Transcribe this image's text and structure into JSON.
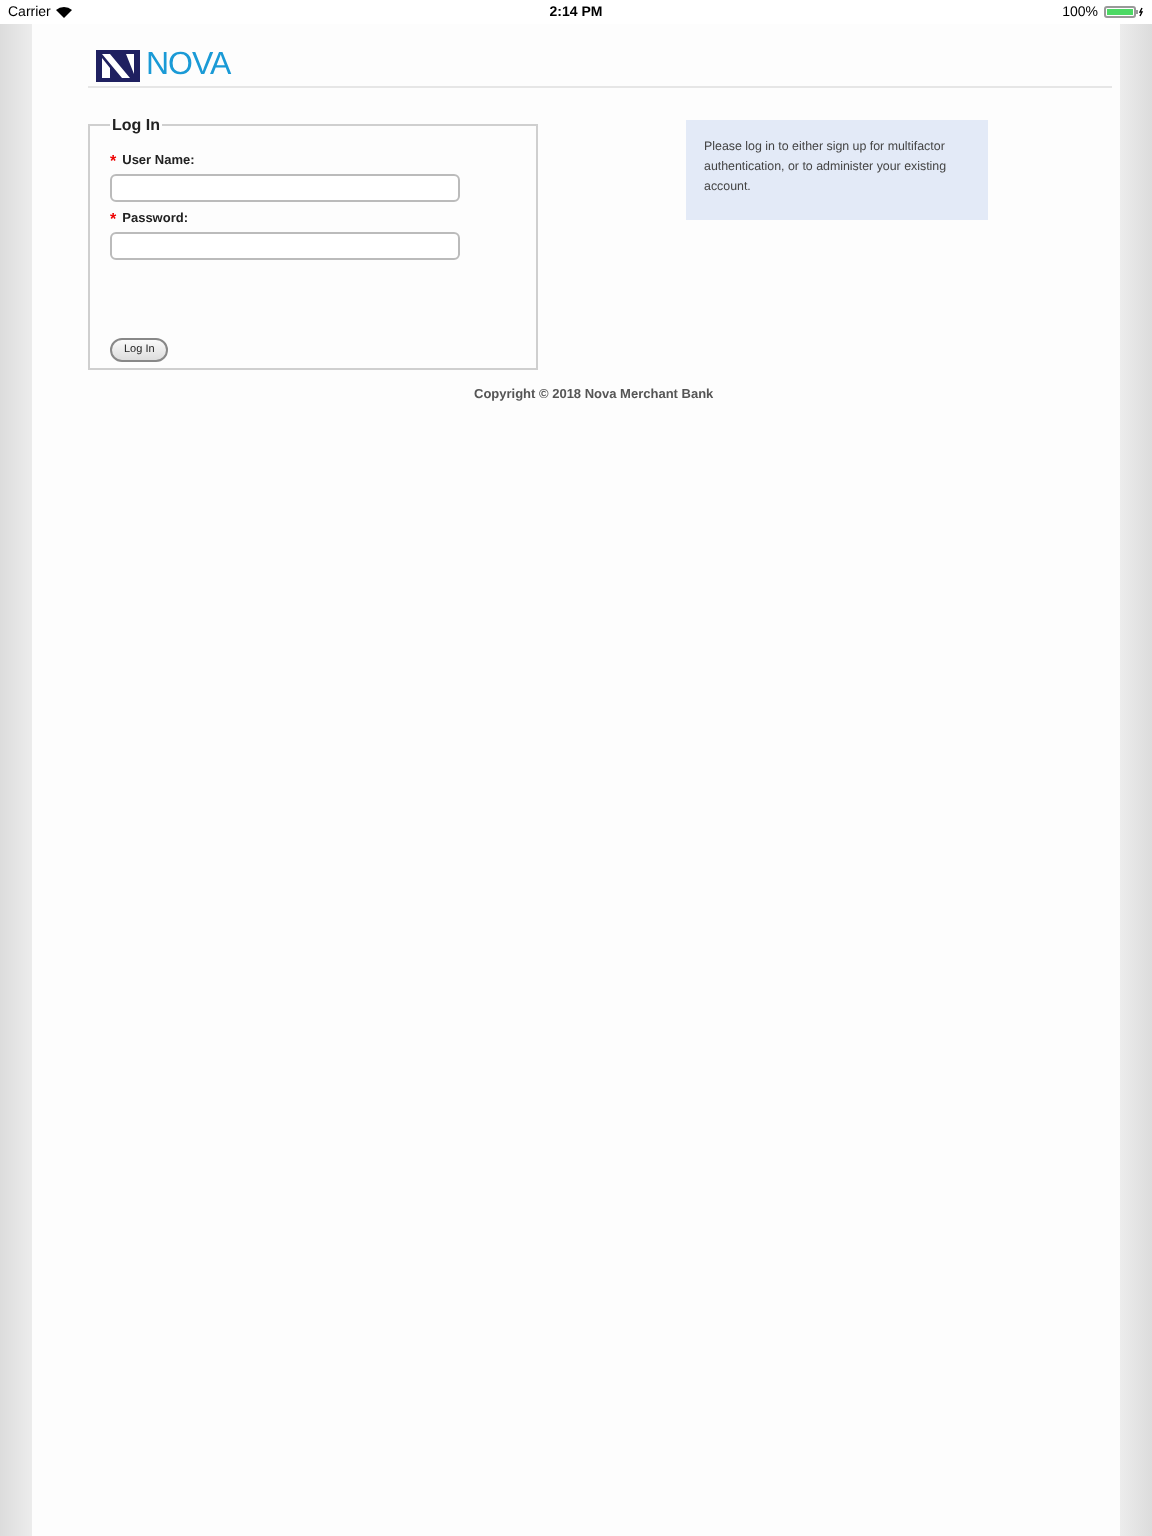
{
  "status_bar": {
    "carrier": "Carrier",
    "time": "2:14 PM",
    "battery": "100%"
  },
  "logo": {
    "text": "NOVA"
  },
  "login": {
    "legend": "Log In",
    "fields": [
      {
        "mark": "*",
        "label": "User Name:"
      },
      {
        "mark": "*",
        "label": "Password:"
      }
    ],
    "button": "Log In"
  },
  "info": "Please log in to either sign up for multifactor authentication, or to administer your existing account.",
  "footer": "Copyright © 2018 Nova Merchant Bank"
}
